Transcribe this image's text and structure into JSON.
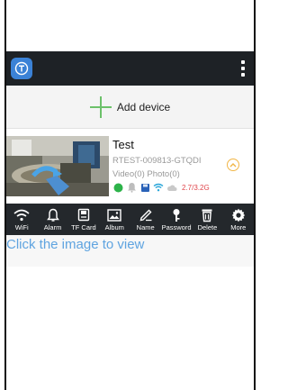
{
  "app": {
    "logo_icon": "app-logo-icon",
    "menu_icon": "more-vertical-icon"
  },
  "add_device": {
    "label": "Add device",
    "icon": "plus-icon",
    "accent": "#6cc16a"
  },
  "device": {
    "name": "Test",
    "id": "RTEST-009813-GTQDI",
    "counts": "Video(0)  Photo(0)",
    "signal": "2.7/3.2G",
    "status_icons": [
      "online-dot-icon",
      "bell-icon",
      "sd-card-icon",
      "wifi-icon",
      "cloud-icon"
    ]
  },
  "toolbar": [
    {
      "label": "WiFi",
      "icon": "wifi-icon"
    },
    {
      "label": "Alarm",
      "icon": "bell-icon"
    },
    {
      "label": "TF Card",
      "icon": "sd-card-icon"
    },
    {
      "label": "Album",
      "icon": "album-icon"
    },
    {
      "label": "Name",
      "icon": "pencil-icon"
    },
    {
      "label": "Password",
      "icon": "key-icon"
    },
    {
      "label": "Delete",
      "icon": "trash-icon"
    },
    {
      "label": "More",
      "icon": "gear-icon"
    }
  ],
  "hint": {
    "text": "Click the image to view",
    "color": "#5fa4e0"
  }
}
